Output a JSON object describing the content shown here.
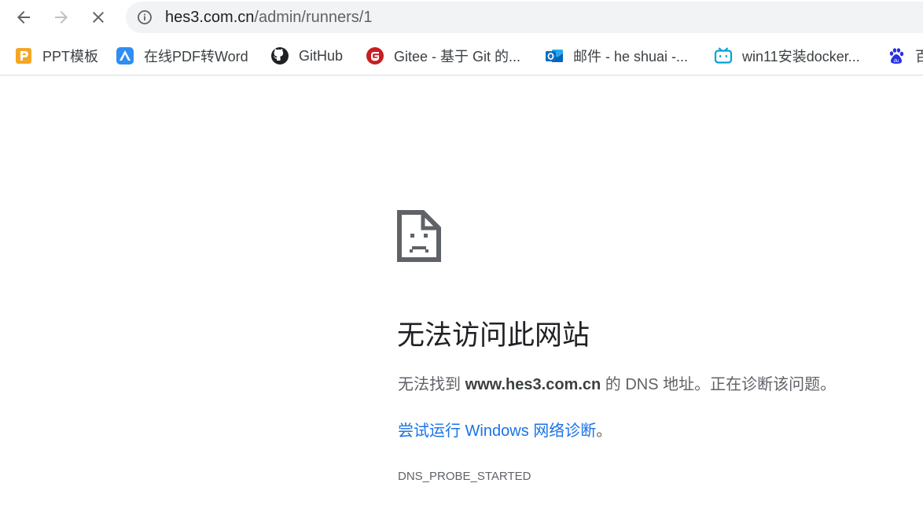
{
  "browser": {
    "url_host": "hes3.com.cn",
    "url_path": "/admin/runners/1",
    "nav_icons": [
      "back-icon",
      "forward-icon",
      "stop-loading-icon",
      "site-info-icon"
    ]
  },
  "bookmarks": [
    {
      "label": "PPT模板",
      "icon": "ppt-icon",
      "color": "#f5a623"
    },
    {
      "label": "在线PDF转Word",
      "icon": "pdf-convert-icon",
      "color": "#2f8ef0"
    },
    {
      "label": "GitHub",
      "icon": "github-icon",
      "color": "#202124"
    },
    {
      "label": "Gitee - 基于 Git 的...",
      "icon": "gitee-icon",
      "color": "#c71d23"
    },
    {
      "label": "邮件 - he shuai -...",
      "icon": "outlook-icon",
      "color": "#0f6cbd"
    },
    {
      "label": "win11安装docker...",
      "icon": "bilibili-icon",
      "color": "#00a1d6"
    },
    {
      "label": "百",
      "icon": "baidu-icon",
      "color": "#2932e1"
    }
  ],
  "error": {
    "title": "无法访问此网站",
    "msg_prefix": "无法找到 ",
    "msg_host": "www.hes3.com.cn",
    "msg_suffix": " 的 DNS 地址。正在诊断该问题。",
    "link_text": "尝试运行 Windows 网络诊断",
    "link_suffix": "。",
    "code": "DNS_PROBE_STARTED"
  }
}
